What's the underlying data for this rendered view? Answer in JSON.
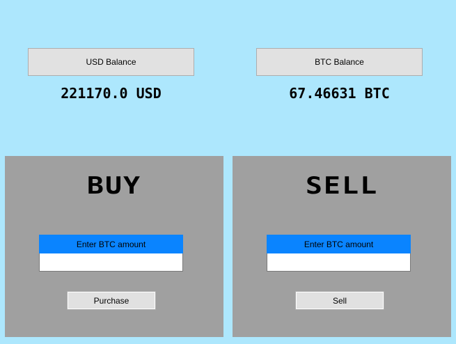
{
  "balances": {
    "usd_button_label": "USD Balance",
    "btc_button_label": "BTC Balance",
    "usd_value": "221170.0 USD",
    "btc_value": "67.46631 BTC"
  },
  "buy_panel": {
    "title": "BUY",
    "input_label": "Enter BTC amount",
    "input_value": "",
    "action_label": "Purchase"
  },
  "sell_panel": {
    "title": "SELL",
    "input_label": "Enter BTC amount",
    "input_value": "",
    "action_label": "Sell"
  },
  "colors": {
    "background": "#ade7fd",
    "panel": "#a0a0a0",
    "input_label_bg": "#0a84ff",
    "button_bg": "#e1e1e1"
  }
}
